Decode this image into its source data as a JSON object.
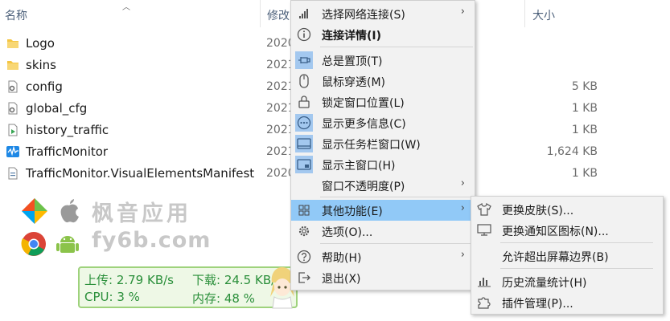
{
  "explorer": {
    "columns": {
      "name": "名称",
      "modified": "修改",
      "size": "大小"
    },
    "files": [
      {
        "name": "Logo",
        "date": "2020",
        "size": "",
        "icon": "folder-icon"
      },
      {
        "name": "skins",
        "date": "2021",
        "size": "",
        "icon": "folder-icon"
      },
      {
        "name": "config",
        "date": "2021",
        "size": "5 KB",
        "icon": "settings-file-icon"
      },
      {
        "name": "global_cfg",
        "date": "2021",
        "size": "1 KB",
        "icon": "settings-file-icon"
      },
      {
        "name": "history_traffic",
        "date": "2021",
        "size": "1 KB",
        "icon": "media-file-icon"
      },
      {
        "name": "TrafficMonitor",
        "date": "2021",
        "size": "1,624 KB",
        "icon": "app-icon"
      },
      {
        "name": "TrafficMonitor.VisualElementsManifest",
        "date": "2020",
        "size": "1 KB",
        "icon": "xml-file-icon"
      }
    ]
  },
  "watermark": {
    "line1": "枫音应用",
    "line2": "fy6b.com"
  },
  "traffic_widget": {
    "upload": "上传: 2.79 KB/s",
    "download": "下载: 24.5 KB/s",
    "cpu": "CPU: 3 %",
    "memory": "内存: 48 %"
  },
  "context_menu": {
    "items": [
      {
        "label": "选择网络连接(S)",
        "icon": "signal-bars-icon",
        "submenu": true
      },
      {
        "label": "连接详情(I)",
        "icon": "info-icon",
        "bold": true
      },
      {
        "label": "总是置顶(T)",
        "icon": "pin-icon",
        "checked": true
      },
      {
        "label": "鼠标穿透(M)",
        "icon": "mouse-icon"
      },
      {
        "label": "锁定窗口位置(L)",
        "icon": "lock-icon"
      },
      {
        "label": "显示更多信息(C)",
        "icon": "more-icon",
        "checked": true
      },
      {
        "label": "显示任务栏窗口(W)",
        "icon": "taskbar-icon",
        "checked": true
      },
      {
        "label": "显示主窗口(H)",
        "icon": "window-icon",
        "checked": true
      },
      {
        "label": "窗口不透明度(P)",
        "icon": "",
        "submenu": true
      },
      {
        "label": "其他功能(E)",
        "icon": "grid-icon",
        "submenu": true,
        "highlighted": true
      },
      {
        "label": "选项(O)...",
        "icon": "gear-icon"
      },
      {
        "label": "帮助(H)",
        "icon": "help-icon",
        "submenu": true
      },
      {
        "label": "退出(X)",
        "icon": "exit-icon"
      }
    ]
  },
  "submenu": {
    "items": [
      {
        "label": "更换皮肤(S)...",
        "icon": "shirt-icon"
      },
      {
        "label": "更换通知区图标(N)...",
        "icon": "tray-icon"
      },
      {
        "label": "允许超出屏幕边界(B)",
        "icon": ""
      },
      {
        "label": "历史流量统计(H)",
        "icon": "bar-chart-icon"
      },
      {
        "label": "插件管理(P)...",
        "icon": "puzzle-icon"
      }
    ]
  },
  "colors": {
    "menu_highlight": "#91c9f7",
    "checked_icon_bg": "#a3c8ef",
    "widget_green": "#2a8f3a",
    "widget_border": "#9ed27c"
  }
}
